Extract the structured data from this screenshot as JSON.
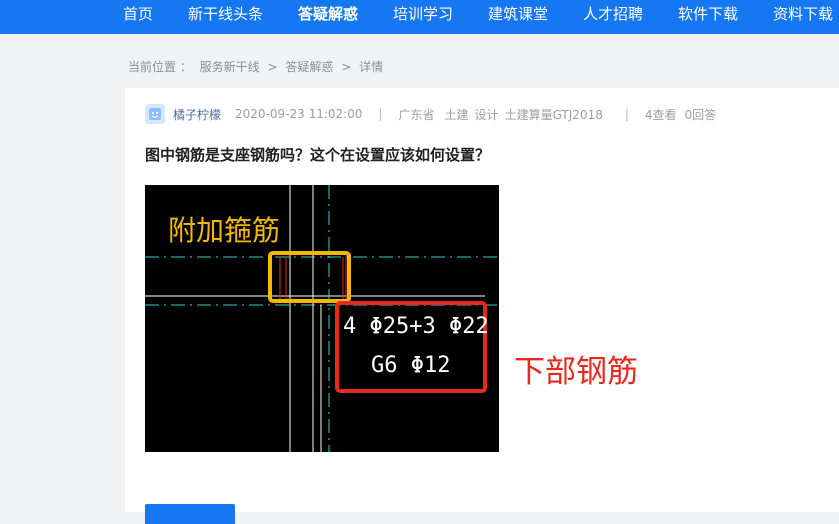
{
  "nav": {
    "items": [
      "首页",
      "新干线头条",
      "答疑解惑",
      "培训学习",
      "建筑课堂",
      "人才招聘",
      "软件下载",
      "资料下载"
    ],
    "active_index": 2
  },
  "breadcrumb": {
    "prefix": "当前位置 ：",
    "items": [
      "服务新干线",
      "答疑解惑",
      "详情"
    ],
    "separator": ">"
  },
  "question": {
    "user": "橘子柠檬",
    "datetime": "2020-09-23 11:02:00",
    "divider": "|",
    "region": "广东省",
    "tags": [
      "土建",
      "设计",
      "土建算量GTJ2018"
    ],
    "views": "4查看",
    "answers": "0回答",
    "title": "图中钢筋是支座钢筋吗？这个在设置应该如何设置？"
  },
  "figure": {
    "label_stirrup": "附加箍筋",
    "rebar_line1": "4 Φ25+3 Φ22",
    "rebar_line2": "G6 Φ12",
    "label_bottom": "下部钢筋",
    "colors": {
      "background": "#000000",
      "axis_line": "#2fd0d8",
      "frame_line": "#ffffff",
      "stirrup_box": "#f5b800",
      "rebar_box": "#e8281e",
      "rebar_text": "#ffffff"
    }
  },
  "colors": {
    "brand": "#1677f2",
    "page_bg": "#f1f2f4"
  }
}
